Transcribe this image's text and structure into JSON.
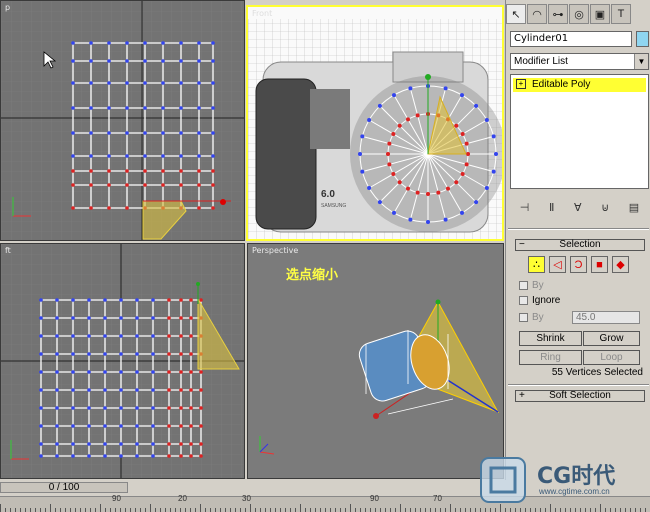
{
  "viewports": {
    "top": {
      "label": "p"
    },
    "front": {
      "label": "Front"
    },
    "left": {
      "label": "ft"
    },
    "perspective": {
      "label": "Perspective",
      "caption": "选点缩小"
    },
    "front_camera_text": {
      "model": "6.0",
      "brand": "SAMSUNG"
    }
  },
  "command_panel": {
    "tabs": [
      {
        "icon": "cursor-icon",
        "glyph": "↖"
      },
      {
        "icon": "modify-icon",
        "glyph": "◠"
      },
      {
        "icon": "hierarchy-icon",
        "glyph": "⊶"
      },
      {
        "icon": "motion-icon",
        "glyph": "◎"
      },
      {
        "icon": "display-icon",
        "glyph": "▣"
      },
      {
        "icon": "utilities-icon",
        "glyph": "T"
      }
    ],
    "object_name": "Cylinder01",
    "object_color": "#8fd6f0",
    "modifier_list": "Modifier List",
    "stack_item": "Editable Poly",
    "stack_tools": [
      "⊣",
      "Ⅱ",
      "∀",
      "⊍",
      "▤"
    ],
    "selection": {
      "title": "Selection",
      "by_vertex": "By",
      "ignore_backfacing": "Ignore",
      "by_angle": "By",
      "angle_value": "45.0",
      "shrink": "Shrink",
      "grow": "Grow",
      "ring": "Ring",
      "loop": "Loop",
      "status": "55 Vertices Selected"
    },
    "soft_selection": {
      "title": "Soft Selection"
    }
  },
  "timeline": {
    "frame": "0 / 100",
    "ruler_labels": [
      "90",
      "20",
      "30",
      "90",
      "70"
    ]
  },
  "watermark": {
    "brand": "CG时代",
    "url": "www.cgtime.com.cn"
  },
  "colors": {
    "accent": "#ffff33",
    "viewport_bg": "#737373",
    "panel_bg": "#d4d0c8"
  }
}
